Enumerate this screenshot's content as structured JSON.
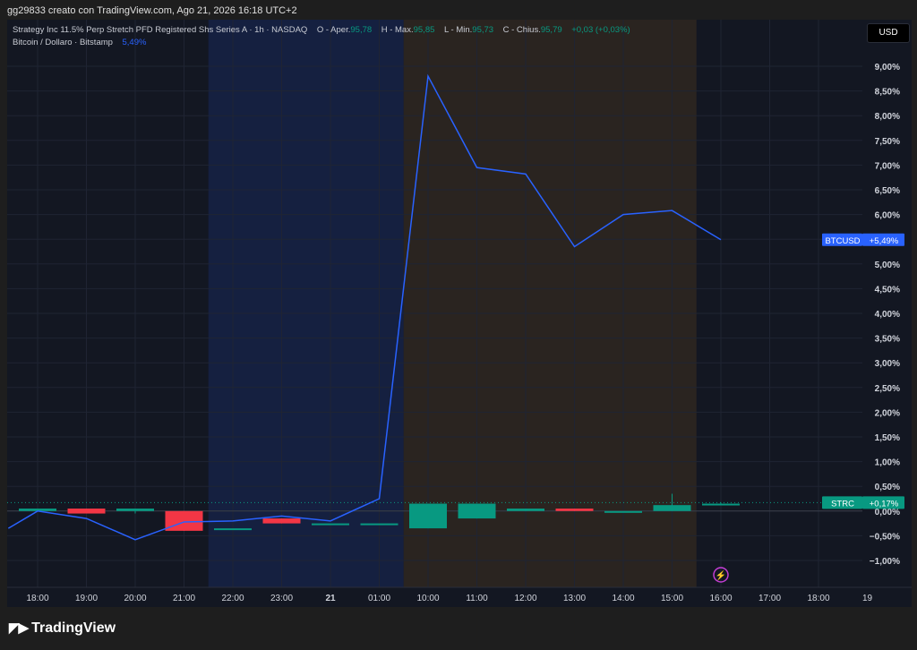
{
  "caption": "gg29833 creato con TradingView.com, Ago 21, 2026 16:18 UTC+2",
  "legend": {
    "symbol": "Strategy Inc 11.5% Perp Stretch PFD Registered Shs Series A · 1h · NASDAQ",
    "o_label": "O - Aper.",
    "o_value": "95,78",
    "h_label": "H - Max.",
    "h_value": "95,85",
    "l_label": "L - Min.",
    "l_value": "95,73",
    "c_label": "C - Chius.",
    "c_value": "95,79",
    "change": "+0,03 (+0,03%)",
    "compare_name": "Bitcoin / Dollaro · Bitstamp",
    "compare_value": "5,49%"
  },
  "currency_button": "USD",
  "watermark": "TradingView",
  "colors": {
    "background": "#131722",
    "up": "#089981",
    "down": "#f23645",
    "compare_line": "#2962ff",
    "session_pre": "#152040",
    "session_post": "#2a2420"
  },
  "chart_data": {
    "type": "line",
    "y_axis": {
      "unit": "%",
      "range": [
        -1.5,
        9.5
      ],
      "ticks": [
        9.0,
        8.5,
        8.0,
        7.5,
        7.0,
        6.5,
        6.0,
        5.5,
        5.0,
        4.5,
        4.0,
        3.5,
        3.0,
        2.5,
        2.0,
        1.5,
        1.0,
        0.5,
        0.0,
        -0.5,
        -1.0
      ],
      "tick_labels": [
        "9,00%",
        "8,50%",
        "8,00%",
        "7,50%",
        "7,00%",
        "6,50%",
        "6,00%",
        "5,50%",
        "5,00%",
        "4,50%",
        "4,00%",
        "3,50%",
        "3,00%",
        "2,50%",
        "2,00%",
        "1,50%",
        "1,00%",
        "0,50%",
        "0,00%",
        "−0,50%",
        "−1,00%"
      ]
    },
    "x_axis": {
      "labels": [
        "18:00",
        "19:00",
        "20:00",
        "21:00",
        "22:00",
        "23:00",
        "21",
        "01:00",
        "10:00",
        "11:00",
        "12:00",
        "13:00",
        "14:00",
        "15:00",
        "16:00",
        "17:00",
        "18:00",
        "19"
      ],
      "bold": [
        "21"
      ]
    },
    "sessions": [
      {
        "kind": "pre",
        "from_index": 3.5,
        "to_index": 7.5
      },
      {
        "kind": "post",
        "from_index": 7.5,
        "to_index": 13.5
      }
    ],
    "series": [
      {
        "name": "BTCUSD",
        "color": "#2962ff",
        "x_index": [
          -0.6,
          0.0,
          1.0,
          2.0,
          3.0,
          4.0,
          5.0,
          6.0,
          7.0,
          8.0,
          9.0,
          10.0,
          11.0,
          12.0,
          13.0,
          14.0
        ],
        "values": [
          -0.35,
          0.0,
          -0.15,
          -0.58,
          -0.22,
          -0.2,
          -0.1,
          -0.2,
          0.25,
          8.8,
          6.95,
          6.82,
          5.35,
          6.0,
          6.08,
          5.49
        ]
      }
    ],
    "candles": {
      "name": "STRC",
      "x_index": [
        0,
        1,
        2,
        3,
        4,
        5,
        6,
        7,
        8,
        9,
        10,
        11,
        12,
        13,
        14
      ],
      "open": [
        0.0,
        0.05,
        0.0,
        0.0,
        -0.35,
        -0.15,
        -0.25,
        -0.25,
        -0.35,
        -0.15,
        0.0,
        0.05,
        0.0,
        0.0,
        0.15
      ],
      "close": [
        0.05,
        -0.05,
        0.05,
        -0.4,
        -0.35,
        -0.25,
        -0.25,
        -0.25,
        0.15,
        0.15,
        0.05,
        0.0,
        0.0,
        0.12,
        0.15
      ],
      "high": [
        0.05,
        0.05,
        0.05,
        0.0,
        -0.35,
        -0.15,
        -0.25,
        -0.25,
        0.15,
        0.15,
        0.05,
        0.05,
        0.0,
        0.35,
        0.17
      ],
      "low": [
        0.0,
        -0.05,
        -0.05,
        -0.4,
        -0.35,
        -0.25,
        -0.25,
        -0.25,
        -0.35,
        -0.15,
        0.0,
        0.0,
        0.0,
        0.0,
        0.15
      ]
    },
    "labels": [
      {
        "series": "BTCUSD",
        "text_name": "BTCUSD",
        "text_value": "+5,49%",
        "value": 5.49,
        "color": "#2962ff"
      },
      {
        "series": "STRC",
        "text_name": "STRC",
        "text_value": "+0,17%",
        "value": 0.17,
        "color": "#089981"
      }
    ]
  }
}
